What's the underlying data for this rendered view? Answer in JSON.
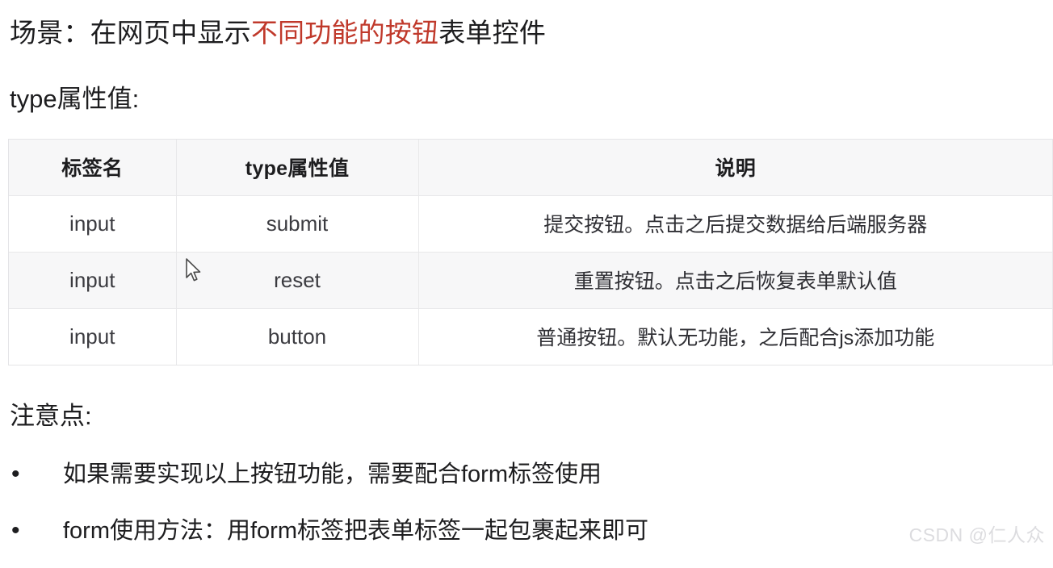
{
  "scene": {
    "prefix": "场景：在网页中显示",
    "highlight": "不同功能的按钮",
    "suffix": "表单控件",
    "highlight_color": "#c0392b"
  },
  "subheading": "type属性值:",
  "table": {
    "columns": [
      "标签名",
      "type属性值",
      "说明"
    ],
    "rows": [
      {
        "tag": "input",
        "type_value": "submit",
        "description": "提交按钮。点击之后提交数据给后端服务器"
      },
      {
        "tag": "input",
        "type_value": "reset",
        "description": "重置按钮。点击之后恢复表单默认值"
      },
      {
        "tag": "input",
        "type_value": "button",
        "description": "普通按钮。默认无功能，之后配合js添加功能"
      }
    ]
  },
  "notes": {
    "title": "注意点:",
    "bullet_marker": "•",
    "items": [
      "如果需要实现以上按钮功能，需要配合form标签使用",
      "form使用方法：用form标签把表单标签一起包裹起来即可"
    ]
  },
  "watermark": "CSDN @仁人众"
}
